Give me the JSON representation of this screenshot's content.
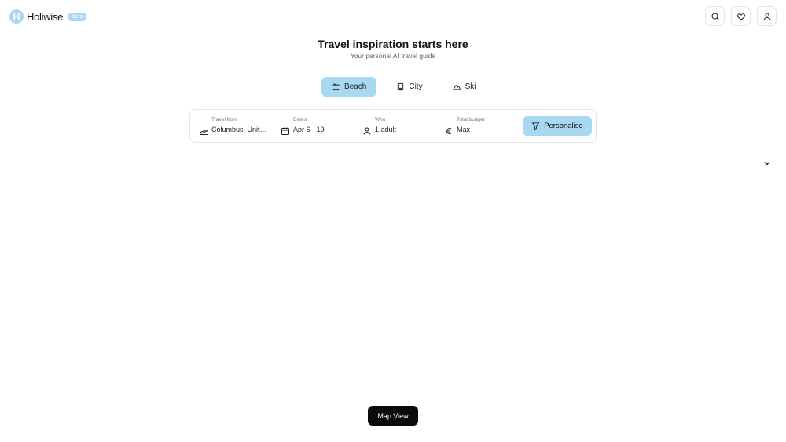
{
  "brand": {
    "mark": "H",
    "name": "Holiwise",
    "badge": "Beta"
  },
  "header": {
    "icons": [
      "search-icon",
      "heart-icon",
      "user-icon"
    ]
  },
  "hero": {
    "title": "Travel inspiration starts here",
    "subtitle": "Your personal AI travel guide"
  },
  "tabs": [
    {
      "label": "Beach",
      "icon": "palm-tree-icon",
      "active": true
    },
    {
      "label": "City",
      "icon": "building-icon",
      "active": false
    },
    {
      "label": "Ski",
      "icon": "mountain-icon",
      "active": false
    }
  ],
  "search": {
    "from": {
      "label": "Travel from",
      "value": "Columbus, United States",
      "icon": "plane-takeoff-icon"
    },
    "dates": {
      "label": "Dates",
      "value": "Apr 6 - 19",
      "icon": "calendar-icon"
    },
    "who": {
      "label": "Who",
      "value": "1 adult",
      "icon": "user-icon"
    },
    "budget": {
      "label": "Total budget",
      "value": "Max",
      "icon": "euro-icon"
    },
    "personalise": {
      "label": "Personalise",
      "icon": "filter-icon"
    }
  },
  "map_view": {
    "label": "Map View"
  },
  "colors": {
    "accent": "#a8d8f2",
    "dark_button": "#0b0b0b"
  }
}
